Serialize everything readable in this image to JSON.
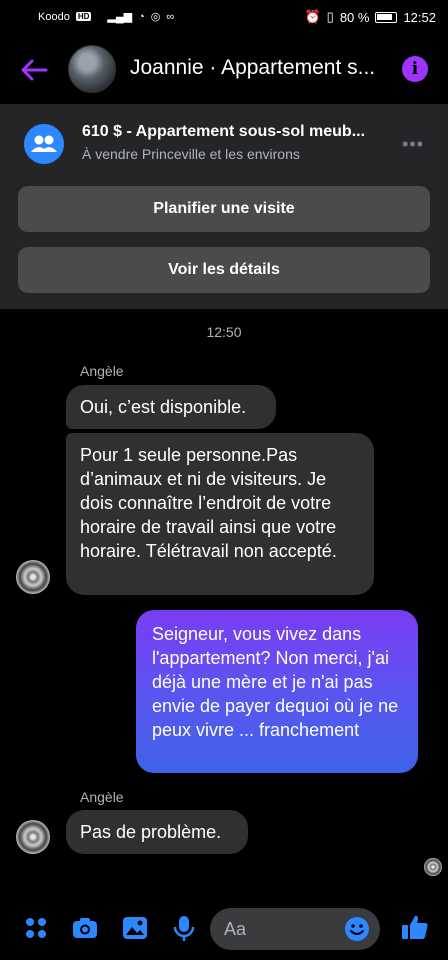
{
  "status_bar": {
    "carrier": "Koodo",
    "hd_label": "HD",
    "battery": "80 %",
    "time": "12:52"
  },
  "header": {
    "title": "Joannie · Appartement s...",
    "info_label": "i"
  },
  "listing": {
    "title": "610 $ - Appartement sous-sol meub...",
    "subtitle": "À vendre Princeville et les environs",
    "more_label": "•••",
    "schedule_button": "Planifier une visite",
    "details_button": "Voir les détails"
  },
  "chat": {
    "timestamp": "12:50",
    "messages": [
      {
        "sender": "Angèle",
        "text": "Oui, c’est disponible."
      },
      {
        "text": "Pour 1 seule personne.Pas d’animaux et ni de visiteurs. Je dois connaître l’endroit de votre horaire de travail ainsi que votre horaire. Télétravail non accepté."
      },
      {
        "text": "Seigneur, vous vivez dans l'appartement? Non merci, j'ai déjà une mère et je n'ai pas envie de payer dequoi où je ne peux vivre ... franchement"
      },
      {
        "sender": "Angèle",
        "text": "Pas de problème."
      }
    ]
  },
  "composer": {
    "placeholder": "Aa"
  },
  "colors": {
    "accent_purple": "#a033ff",
    "accent_blue": "#2d88ff",
    "outgoing_top": "#7a3cf2",
    "outgoing_bottom": "#3e63e8",
    "incoming_bubble": "#303030"
  }
}
